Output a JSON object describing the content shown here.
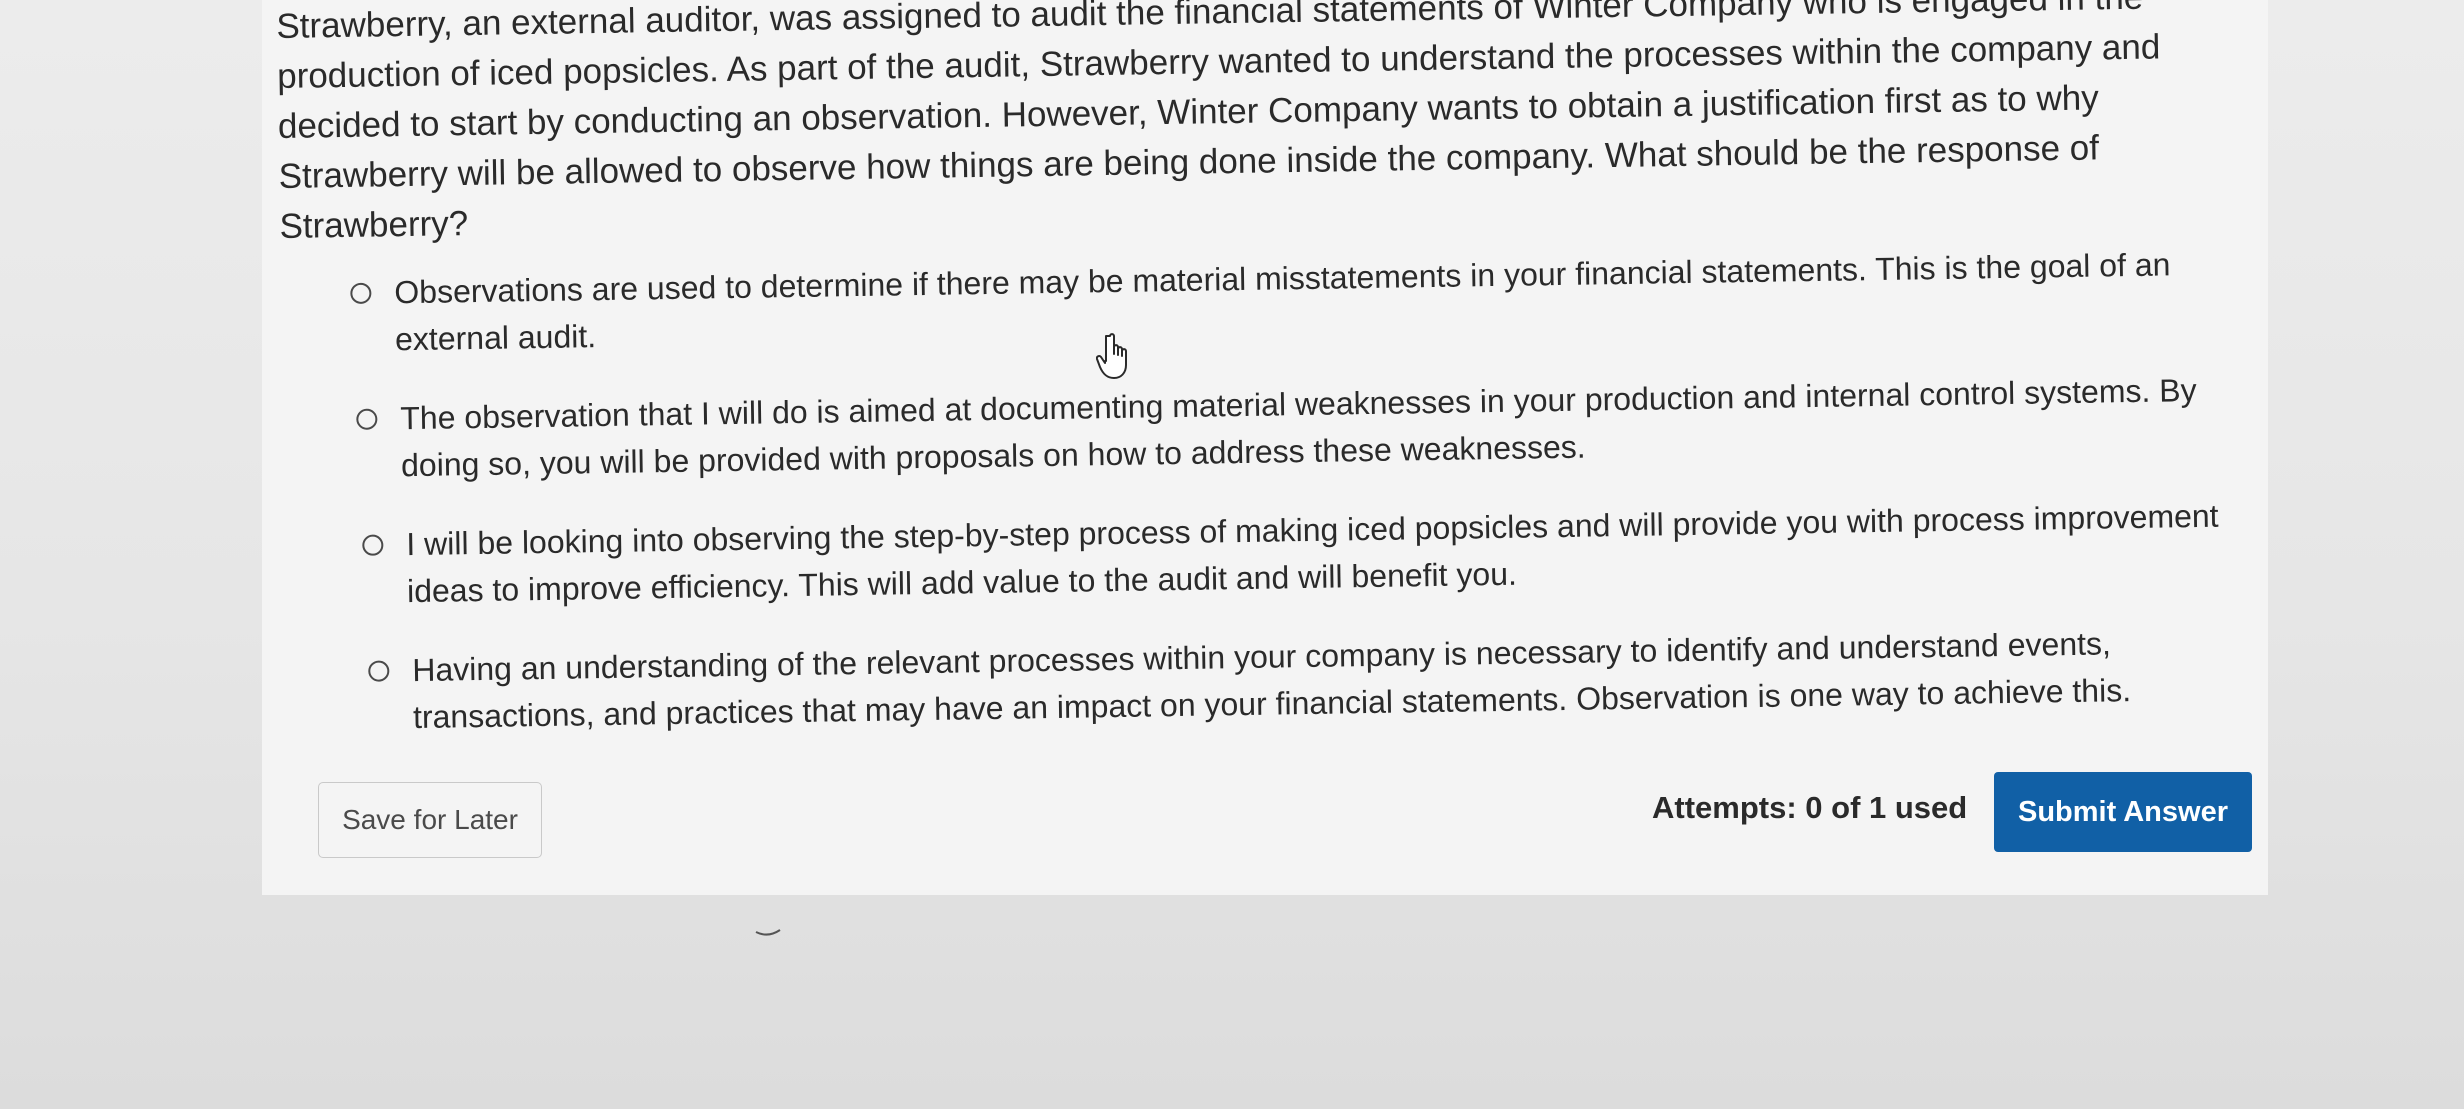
{
  "question": {
    "text": "Strawberry, an external auditor, was assigned to audit the financial statements of Winter Company who is engaged in the production of iced popsicles. As part of the audit, Strawberry wanted to understand the processes within the company and decided to start by conducting an observation. However, Winter Company wants to obtain a justification first as to why Strawberry will be allowed to observe how things are being done inside the company. What should be the response of Strawberry?"
  },
  "options": [
    {
      "label": "Observations are used to determine if there may be material misstatements in your financial statements. This is the goal of an external audit."
    },
    {
      "label": "The observation that I will do is aimed at documenting material weaknesses in your production and internal control systems. By doing so, you will be provided with proposals on how to address these weaknesses."
    },
    {
      "label": "I will be looking into observing the step-by-step process of making iced popsicles and will provide you with process improvement ideas to improve efficiency. This will add value to the audit and will benefit you."
    },
    {
      "label": "Having an understanding of the relevant processes within your company is necessary to identify and understand events, transactions, and practices that may have an impact on your financial statements. Observation is one way to achieve this."
    }
  ],
  "footer": {
    "save_label": "Save for Later",
    "attempts_text": "Attempts: 0 of 1 used",
    "submit_label": "Submit Answer"
  },
  "colors": {
    "submit_bg": "#1160a6",
    "card_bg": "#f4f4f4"
  },
  "icons": {
    "cursor": "hand-pointer-icon",
    "radio": "radio-circle-icon"
  }
}
